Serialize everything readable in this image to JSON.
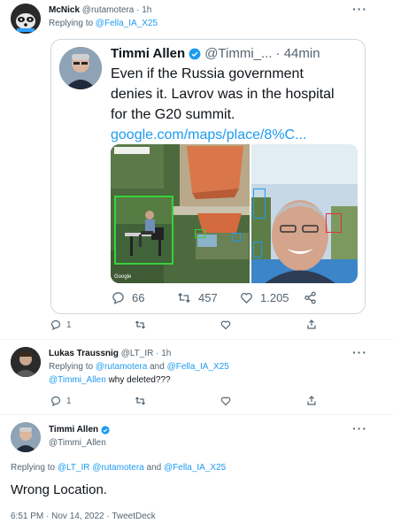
{
  "tweet1": {
    "name": "McNick",
    "handle": "@rutamotera",
    "time": "· 1h",
    "replying_prefix": "Replying to",
    "replying_to": "@Fella_IA_X25",
    "quoted": {
      "name": "Timmi Allen",
      "handle": "@Timmi_...",
      "time": "· 44min",
      "text_lines": [
        "Even if the Russia government",
        "denies it. Lavrov was in the hospital",
        "for the G20 summit."
      ],
      "link": "google.com/maps/place/8%C...",
      "image_label": "Google",
      "stats": {
        "replies": "66",
        "retweets": "457",
        "likes": "1.205"
      }
    },
    "actions": {
      "replies": "1"
    }
  },
  "tweet2": {
    "name": "Lukas Traussnig",
    "handle": "@LT_IR",
    "time": "· 1h",
    "replying_prefix": "Replying to",
    "replying_to_1": "@rutamotera",
    "and": "and",
    "replying_to_2": "@Fella_IA_X25",
    "mention": "@Timmi_Allen",
    "text": "why deleted???",
    "actions": {
      "replies": "1"
    }
  },
  "tweet3": {
    "name": "Timmi Allen",
    "handle": "@Timmi_Allen",
    "replying_prefix": "Replying to",
    "replying_to_1": "@LT_IR",
    "replying_to_2": "@rutamotera",
    "and": "and",
    "replying_to_3": "@Fella_IA_X25",
    "text": "Wrong Location.",
    "timestamp": "6:51 PM · Nov 14, 2022 · TweetDeck"
  },
  "colors": {
    "accent": "#1d9bf0",
    "verified": "#1d9bf0",
    "text": "#0f1419",
    "secondary": "#536471",
    "border": "#cfd9de"
  }
}
